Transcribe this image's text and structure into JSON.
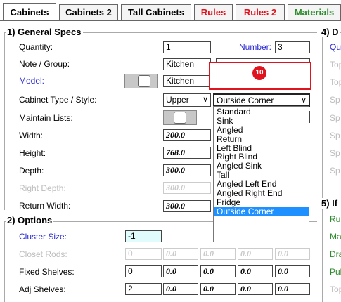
{
  "tabs": [
    {
      "label": "Cabinets",
      "color": "#000000"
    },
    {
      "label": "Cabinets 2",
      "color": "#000000"
    },
    {
      "label": "Tall Cabinets",
      "color": "#000000"
    },
    {
      "label": "Rules",
      "color": "#e0141e"
    },
    {
      "label": "Rules 2",
      "color": "#e0141e"
    },
    {
      "label": "Materials",
      "color": "#2e8b2e"
    }
  ],
  "general": {
    "legend": "1) General Specs",
    "quantity_label": "Quantity:",
    "quantity_value": "1",
    "number_label": "Number:",
    "number_value": "3",
    "note_label": "Note / Group:",
    "note_value": "Kitchen",
    "model_label": "Model:",
    "model_value": "Kitchen",
    "type_label": "Cabinet Type / Style:",
    "type_value": "Upper",
    "style_value": "Outside Corner",
    "maintain_label": "Maintain Lists:",
    "width_label": "Width:",
    "width_value": "200.0",
    "height_label": "Height:",
    "height_value": "768.0",
    "depth_label": "Depth:",
    "depth_value": "300.0",
    "right_depth_label": "Right Depth:",
    "right_depth_value": "300.0",
    "return_width_label": "Return Width:",
    "return_width_value": "300.0"
  },
  "options": {
    "legend": "2) Options",
    "cluster_label": "Cluster Size:",
    "cluster_value": "-1",
    "closet_label": "Closet Rods:",
    "closet_values": [
      "0",
      "0.0",
      "0.0",
      "0.0",
      "0.0"
    ],
    "fixed_label": "Fixed Shelves:",
    "fixed_values": [
      "0",
      "0.0",
      "0.0",
      "0.0",
      "0.0"
    ],
    "adj_label": "Adj Shelves:",
    "adj_values": [
      "2",
      "0.0",
      "0.0",
      "0.0",
      "0.0"
    ]
  },
  "dropdown": {
    "options": [
      "Standard",
      "Sink",
      "Angled",
      "Return",
      "Left Blind",
      "Right Blind",
      "Angled Sink",
      "Tall",
      "Angled Left End",
      "Angled Right End",
      "Fridge",
      "Outside Corner"
    ],
    "selected_index": 11
  },
  "annotation": {
    "badge": "10"
  },
  "right_col": {
    "legend_4": "4) D",
    "legend_5": "5) If",
    "items_top": [
      "Qu",
      "Top",
      "Top",
      "Sp",
      "Sp",
      "Sp",
      "Sp",
      "Sp"
    ],
    "items_bottom": [
      "Ru",
      "Ma",
      "Dra",
      "Pul",
      "Top"
    ]
  }
}
